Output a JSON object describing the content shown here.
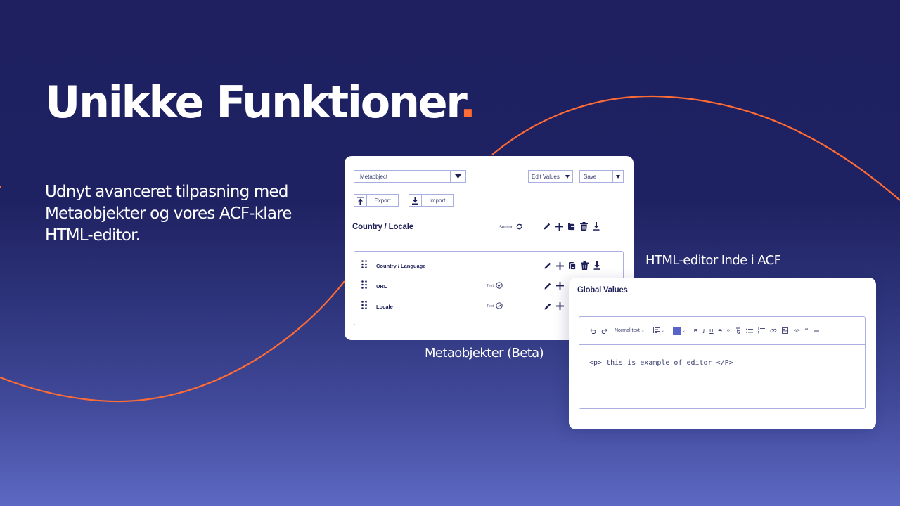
{
  "hero": {
    "title": "Unikke Funktioner",
    "title_dot": ".",
    "subtitle": "Udnyt avanceret tilpasning med Metaobjekter og vores ACF-klare HTML-editor.",
    "accent_color": "#ff6b35"
  },
  "captions": {
    "metaobjects": "Metaobjekter (Beta)",
    "html_editor": "HTML-editor Inde i ACF"
  },
  "meta_card": {
    "type_select": {
      "value": "Metaobject",
      "icon": "caret-down-icon"
    },
    "edit_select": {
      "value": "Edit Values",
      "icon": "caret-down-icon"
    },
    "save_select": {
      "value": "Save",
      "icon": "caret-down-icon"
    },
    "export_button": {
      "label": "Export",
      "icon": "upload-icon"
    },
    "import_button": {
      "label": "Import",
      "icon": "download-icon"
    },
    "section": {
      "title": "Country / Locale",
      "tag": "Section",
      "tag_icon": "refresh-icon",
      "actions": [
        "pencil-icon",
        "plus-icon",
        "copy-icon",
        "trash-icon",
        "download-icon"
      ]
    },
    "fields": [
      {
        "name": "Country / Language",
        "type": "",
        "actions": [
          "pencil-icon",
          "plus-icon",
          "copy-icon",
          "trash-icon",
          "download-icon"
        ]
      },
      {
        "name": "URL",
        "type": "Text",
        "actions": [
          "pencil-icon",
          "plus-icon"
        ]
      },
      {
        "name": "Locale",
        "type": "Text",
        "actions": [
          "pencil-icon",
          "plus-icon"
        ]
      }
    ]
  },
  "editor_card": {
    "title": "Global Values",
    "toolbar": {
      "undo": "undo-icon",
      "redo": "redo-icon",
      "text_style": "Normal text",
      "align": "align-left-icon",
      "color": "#5964c6",
      "bold": "B",
      "italic": "I",
      "underline": "U",
      "strike": "S",
      "others": [
        "inline-code-icon",
        "clear-format-icon",
        "bullet-list-icon",
        "numbered-list-icon",
        "link-icon",
        "image-icon",
        "code-block-icon",
        "quote-icon",
        "horizontal-rule-icon"
      ]
    },
    "content": "<p> this is example of editor </P>"
  },
  "colors": {
    "bg_top": "#1e2060",
    "bg_bottom": "#5d68c2",
    "curve": "#ff6b35",
    "card_text": "#1e2159",
    "border": "#a9b0e0"
  }
}
